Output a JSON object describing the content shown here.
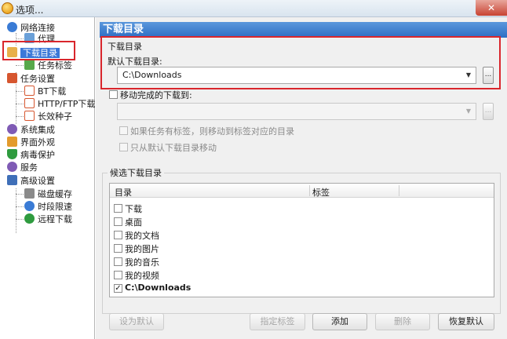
{
  "window": {
    "title": "选项..."
  },
  "tree": [
    {
      "label": "网络连接",
      "icon": "globe-icon",
      "color": "#3a7bd5"
    },
    {
      "label": "代理",
      "icon": "proxy-icon",
      "color": "#6aa0d8"
    },
    {
      "label": "下载目录",
      "icon": "folder-icon",
      "color": "#e8b04a",
      "selected": true
    },
    {
      "label": "任务标签",
      "icon": "tag-icon",
      "color": "#57a84a"
    },
    {
      "label": "任务设置",
      "icon": "task-icon",
      "color": "#d6562f"
    },
    {
      "label": "BT下载",
      "icon": "bt-icon",
      "color": "#d6562f"
    },
    {
      "label": "HTTP/FTP下载",
      "icon": "http-icon",
      "color": "#d6562f"
    },
    {
      "label": "长效种子",
      "icon": "seed-icon",
      "color": "#d6562f"
    },
    {
      "label": "系统集成",
      "icon": "integration-icon",
      "color": "#7f5bb5"
    },
    {
      "label": "界面外观",
      "icon": "appearance-icon",
      "color": "#e39b2c"
    },
    {
      "label": "病毒保护",
      "icon": "shield-icon",
      "color": "#2f9b3f"
    },
    {
      "label": "服务",
      "icon": "service-icon",
      "color": "#7f5bb5"
    },
    {
      "label": "高级设置",
      "icon": "advanced-icon",
      "color": "#3f6fb8"
    },
    {
      "label": "磁盘缓存",
      "icon": "disk-icon",
      "color": "#8a8a8a"
    },
    {
      "label": "时段限速",
      "icon": "clock-icon",
      "color": "#3a7bd5"
    },
    {
      "label": "远程下载",
      "icon": "remote-icon",
      "color": "#2f9b3f"
    }
  ],
  "panel": {
    "header": "下载目录",
    "section_title": "下载目录",
    "default_dir_label": "默认下载目录:",
    "default_dir_value": "C:\\Downloads",
    "browse_label": "...",
    "move_completed_label": "移动完成的下载到:",
    "move_completed_value": "",
    "tag_move_label": "如果任务有标签，则移动到标签对应的目录",
    "only_default_label": "只从默认下载目录移动",
    "candidate_title": "候选下载目录",
    "columns": {
      "dir": "目录",
      "tag": "标签"
    },
    "candidates": [
      {
        "label": "下载",
        "checked": false,
        "bold": false
      },
      {
        "label": "桌面",
        "checked": false,
        "bold": false
      },
      {
        "label": "我的文档",
        "checked": false,
        "bold": false
      },
      {
        "label": "我的图片",
        "checked": false,
        "bold": false
      },
      {
        "label": "我的音乐",
        "checked": false,
        "bold": false
      },
      {
        "label": "我的视频",
        "checked": false,
        "bold": false
      },
      {
        "label": "C:\\Downloads",
        "checked": true,
        "bold": true
      }
    ],
    "buttons": {
      "set_default": "设为默认",
      "assign_tag": "指定标签",
      "add": "添加",
      "delete": "删除",
      "restore_default": "恢复默认"
    }
  },
  "colors": {
    "accent": "#3b78d8",
    "highlight_box": "#d9262c"
  }
}
